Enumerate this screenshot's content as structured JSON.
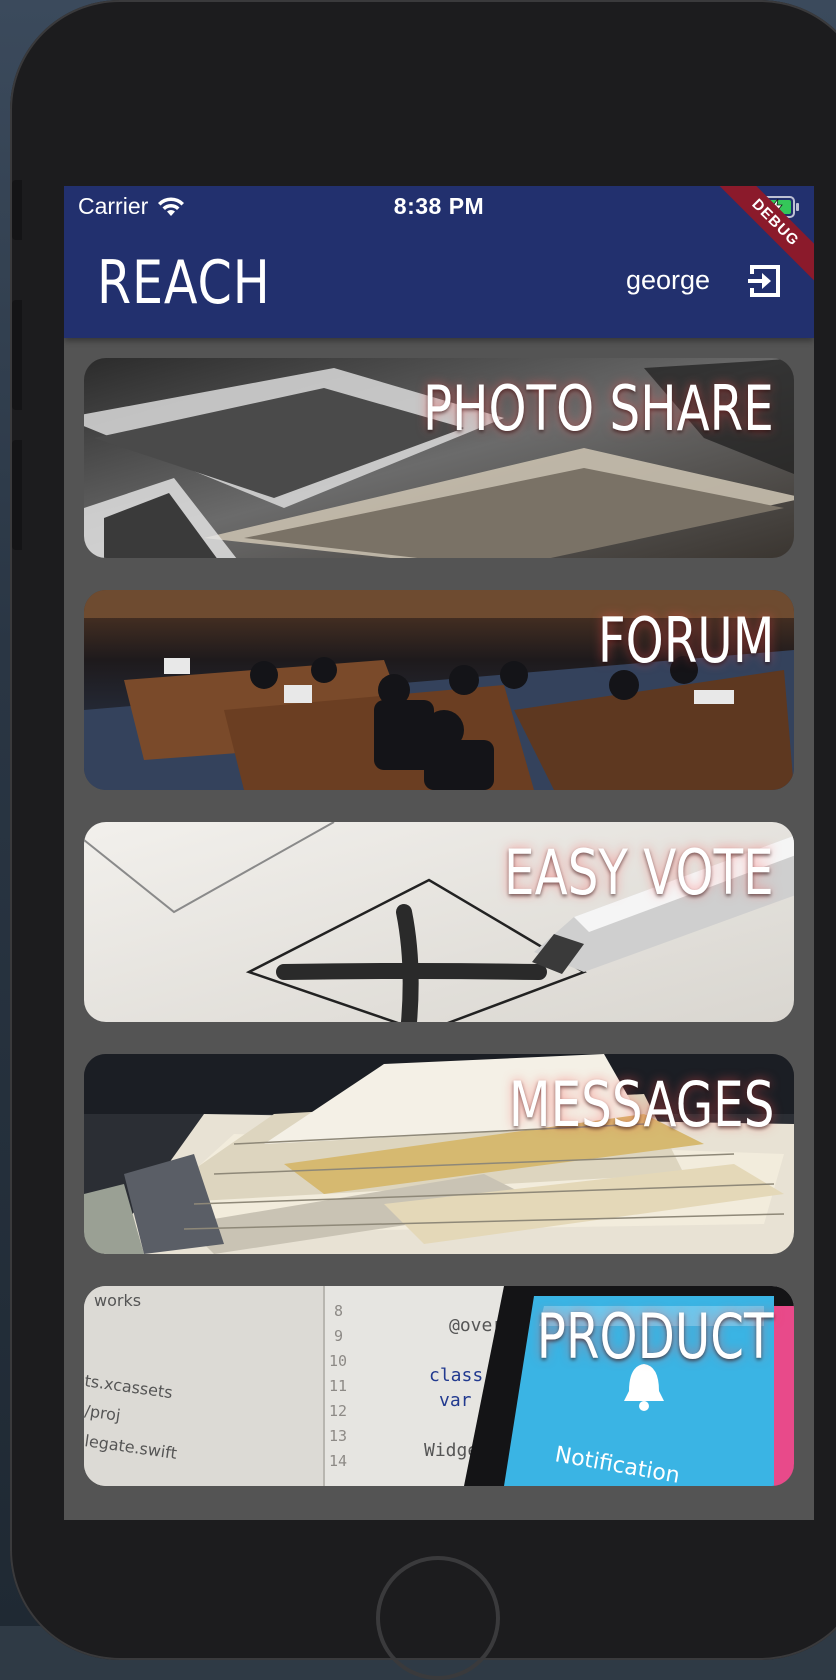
{
  "status_bar": {
    "carrier": "Carrier",
    "time": "8:38 PM",
    "debug_banner": "DEBUG"
  },
  "app_bar": {
    "title": "REACH",
    "username": "george",
    "logout_icon": "logout-icon"
  },
  "tiles": [
    {
      "label": "PHOTO SHARE"
    },
    {
      "label": "FORUM"
    },
    {
      "label": "EASY VOTE"
    },
    {
      "label": "MESSAGES"
    },
    {
      "label": "PRODUCT"
    }
  ],
  "colors": {
    "app_bar": "#22306e",
    "screen_bg": "#545454",
    "debug_ribbon": "#8b1a2b"
  }
}
